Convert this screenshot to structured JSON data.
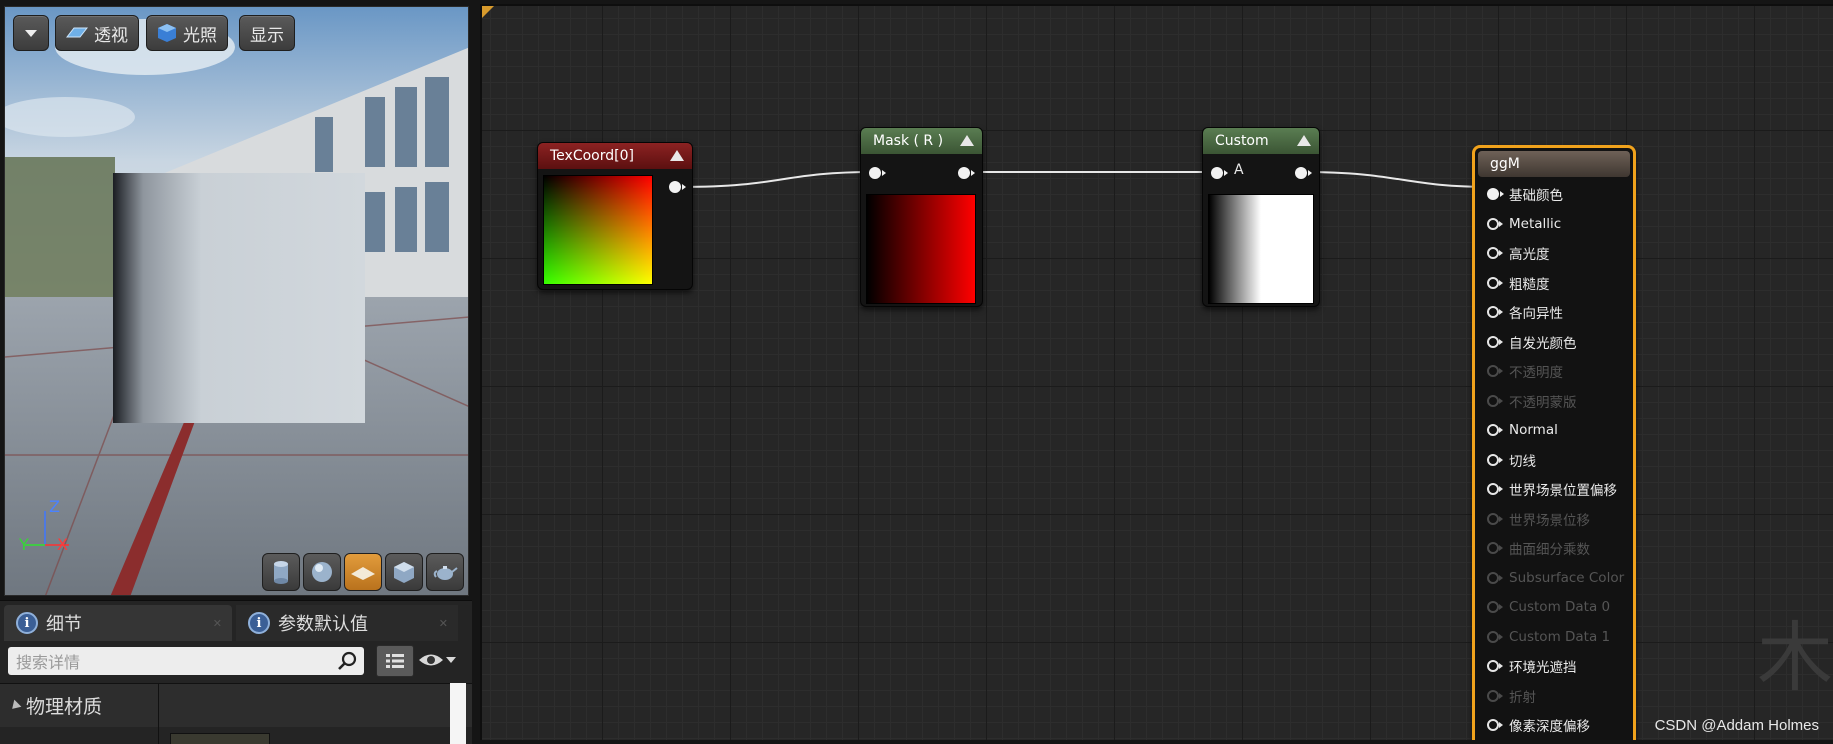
{
  "viewport": {
    "menu_button_icon": "chevron-down-icon",
    "perspective_label": "透视",
    "lighting_label": "光照",
    "show_label": "显示",
    "axis_labels": {
      "z": "Z",
      "y": "Y",
      "x": "X"
    },
    "preview_shapes": [
      "cylinder-icon",
      "sphere-icon",
      "plane-icon",
      "cube-icon",
      "teapot-icon"
    ],
    "active_preview_shape": "plane-icon"
  },
  "details": {
    "tabs": [
      {
        "label": "细节",
        "close": "✕"
      },
      {
        "label": "参数默认值",
        "close": "✕"
      }
    ],
    "search_placeholder": "搜索详情",
    "category": "物理材质"
  },
  "graph": {
    "nodes": {
      "texcoord": {
        "title": "TexCoord[0]"
      },
      "mask": {
        "title": "Mask ( R )"
      },
      "custom": {
        "title": "Custom",
        "input_label": "A"
      },
      "result": {
        "title": "ggM",
        "pins": [
          {
            "label": "基础颜色",
            "state": "connected"
          },
          {
            "label": "Metallic",
            "state": "enabled"
          },
          {
            "label": "高光度",
            "state": "enabled"
          },
          {
            "label": "粗糙度",
            "state": "enabled"
          },
          {
            "label": "各向异性",
            "state": "enabled"
          },
          {
            "label": "自发光颜色",
            "state": "enabled"
          },
          {
            "label": "不透明度",
            "state": "disabled"
          },
          {
            "label": "不透明蒙版",
            "state": "disabled"
          },
          {
            "label": "Normal",
            "state": "enabled"
          },
          {
            "label": "切线",
            "state": "enabled"
          },
          {
            "label": "世界场景位置偏移",
            "state": "enabled"
          },
          {
            "label": "世界场景位移",
            "state": "disabled"
          },
          {
            "label": "曲面细分乘数",
            "state": "disabled"
          },
          {
            "label": "Subsurface Color",
            "state": "disabled"
          },
          {
            "label": "Custom Data 0",
            "state": "disabled"
          },
          {
            "label": "Custom Data 1",
            "state": "disabled"
          },
          {
            "label": "环境光遮挡",
            "state": "enabled"
          },
          {
            "label": "折射",
            "state": "disabled"
          },
          {
            "label": "像素深度偏移",
            "state": "enabled"
          }
        ]
      }
    },
    "background_glyph": "木",
    "colors": {
      "selection_outline": "#f0a21c",
      "disabled_text": "#555555"
    }
  },
  "watermark": "CSDN @Addam Holmes"
}
